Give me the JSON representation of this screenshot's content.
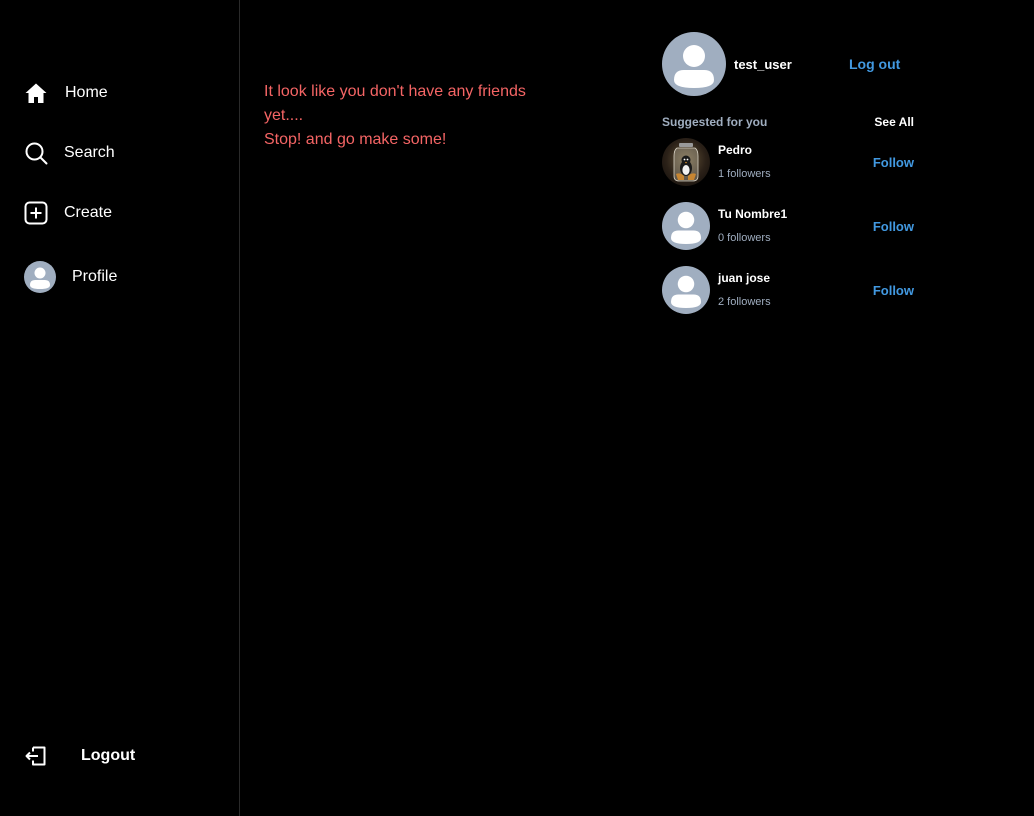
{
  "sidebar": {
    "items": [
      {
        "label": "Home",
        "icon": "home-icon"
      },
      {
        "label": "Search",
        "icon": "search-icon"
      },
      {
        "label": "Create",
        "icon": "plus-square-icon"
      },
      {
        "label": "Profile",
        "icon": "avatar"
      }
    ],
    "logout": {
      "label": "Logout",
      "icon": "logout-icon"
    }
  },
  "feed": {
    "empty_line1": "It look like you don't have any friends yet....",
    "empty_line2": "Stop! and go make some!"
  },
  "current_user": {
    "username": "test_user",
    "logout_label": "Log out"
  },
  "suggested": {
    "title": "Suggested for you",
    "see_all": "See All",
    "follow_label": "Follow",
    "users": [
      {
        "name": "Pedro",
        "followers": "1 followers",
        "avatar": "photo"
      },
      {
        "name": "Tu Nombre1",
        "followers": "0 followers",
        "avatar": "default"
      },
      {
        "name": "juan jose",
        "followers": "2 followers",
        "avatar": "default"
      }
    ]
  },
  "colors": {
    "background": "#000000",
    "accent": "#4299e1",
    "empty_text": "#f56565",
    "muted": "#a0aec0",
    "avatar_bg": "#a0aec0"
  }
}
